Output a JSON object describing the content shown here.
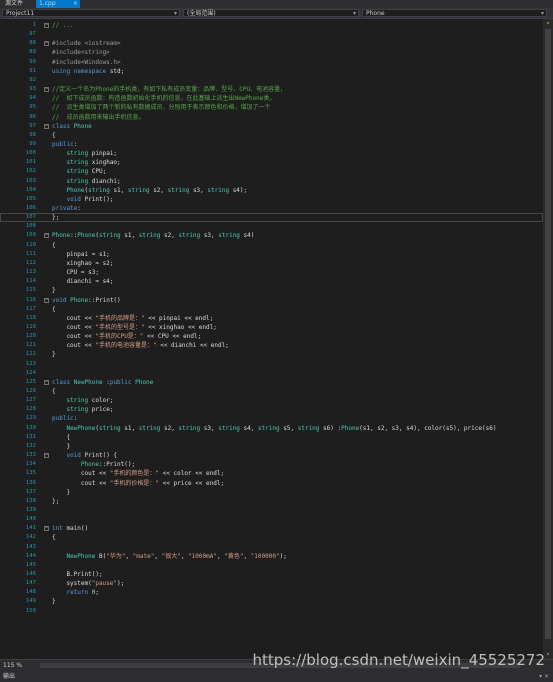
{
  "tabs": {
    "source": "源文件",
    "file": "1.cpp",
    "close": "×"
  },
  "nav": {
    "project": "Project11",
    "scope": "(全局范围)",
    "member": "Phone",
    "chev": "▾"
  },
  "lines": [
    {
      "n": "1",
      "t": "// ..."
    },
    {
      "n": "87",
      "t": ""
    },
    {
      "n": "88",
      "t": "#include <iostream>"
    },
    {
      "n": "89",
      "t": "#include<string>"
    },
    {
      "n": "90",
      "t": "#include<Windows.h>"
    },
    {
      "n": "91",
      "t": "using namespace std;"
    },
    {
      "n": "92",
      "t": ""
    },
    {
      "n": "93",
      "t": "//定义一个名为Phone的手机类，有如下私有成员变量：品牌、型号、CPU、电池容量，"
    },
    {
      "n": "94",
      "t": "//  如下成员函数：构造函数初始化手机的信息，在此基础上派生出NewPhone类，"
    },
    {
      "n": "95",
      "t": "//  派生类增加了两个新的私有数据成员，分别用于表示颜色和价格，增加了一个"
    },
    {
      "n": "96",
      "t": "//  成员函数用来输出手机信息。"
    },
    {
      "n": "97",
      "t": "class Phone"
    },
    {
      "n": "98",
      "t": "{"
    },
    {
      "n": "99",
      "t": "public:"
    },
    {
      "n": "100",
      "t": "    string pinpai;"
    },
    {
      "n": "101",
      "t": "    string xinghao;"
    },
    {
      "n": "102",
      "t": "    string CPU;"
    },
    {
      "n": "103",
      "t": "    string dianchi;"
    },
    {
      "n": "104",
      "t": "    Phone(string s1, string s2, string s3, string s4);"
    },
    {
      "n": "105",
      "t": "    void Print();"
    },
    {
      "n": "106",
      "t": "private:"
    },
    {
      "n": "107",
      "t": "};"
    },
    {
      "n": "108",
      "t": ""
    },
    {
      "n": "109",
      "t": "Phone::Phone(string s1, string s2, string s3, string s4)"
    },
    {
      "n": "110",
      "t": "{"
    },
    {
      "n": "111",
      "t": "    pinpai = s1;"
    },
    {
      "n": "112",
      "t": "    xinghao = s2;"
    },
    {
      "n": "113",
      "t": "    CPU = s3;"
    },
    {
      "n": "114",
      "t": "    dianchi = s4;"
    },
    {
      "n": "115",
      "t": "}"
    },
    {
      "n": "116",
      "t": "void Phone::Print()"
    },
    {
      "n": "117",
      "t": "{"
    },
    {
      "n": "118",
      "t": "    cout << \"手机的品牌是：\" << pinpai << endl;"
    },
    {
      "n": "119",
      "t": "    cout << \"手机的型号是：\" << xinghao << endl;"
    },
    {
      "n": "120",
      "t": "    cout << \"手机的CPU是：\" << CPU << endl;"
    },
    {
      "n": "121",
      "t": "    cout << \"手机的电池容量是：\" << dianchi << endl;"
    },
    {
      "n": "122",
      "t": "}"
    },
    {
      "n": "123",
      "t": ""
    },
    {
      "n": "124",
      "t": ""
    },
    {
      "n": "125",
      "t": "class NewPhone :public Phone"
    },
    {
      "n": "126",
      "t": "{"
    },
    {
      "n": "127",
      "t": "    string color;"
    },
    {
      "n": "128",
      "t": "    string price;"
    },
    {
      "n": "129",
      "t": "public:"
    },
    {
      "n": "130",
      "t": "    NewPhone(string s1, string s2, string s3, string s4, string s5, string s6) :Phone(s1, s2, s3, s4), color(s5), price(s6)"
    },
    {
      "n": "131",
      "t": "    {"
    },
    {
      "n": "132",
      "t": "    }"
    },
    {
      "n": "133",
      "t": "    void Print() {"
    },
    {
      "n": "134",
      "t": "        Phone::Print();"
    },
    {
      "n": "135",
      "t": "        cout << \"手机的颜色是：\" << color << endl;"
    },
    {
      "n": "136",
      "t": "        cout << \"手机的价格是：\" << price << endl;"
    },
    {
      "n": "137",
      "t": "    }"
    },
    {
      "n": "138",
      "t": "};"
    },
    {
      "n": "139",
      "t": ""
    },
    {
      "n": "140",
      "t": ""
    },
    {
      "n": "141",
      "t": "int main()"
    },
    {
      "n": "142",
      "t": "{"
    },
    {
      "n": "143",
      "t": ""
    },
    {
      "n": "144",
      "t": "    NewPhone B(\"华为\", \"mate\", \"很大\", \"1000mA\", \"黄色\", \"100000\");"
    },
    {
      "n": "145",
      "t": ""
    },
    {
      "n": "146",
      "t": "    B.Print();"
    },
    {
      "n": "147",
      "t": "    system(\"pause\");"
    },
    {
      "n": "148",
      "t": "    return 0;"
    },
    {
      "n": "149",
      "t": "}"
    },
    {
      "n": "150",
      "t": ""
    }
  ],
  "status": {
    "zoom": "115 %",
    "watermark": "https://blog.csdn.net/weixin_45525272"
  },
  "output": {
    "label": "输出",
    "controls": "▾ ✕"
  },
  "colors": {
    "keyword": "#569cd6",
    "string": "#d69d85",
    "comment": "#57a64a",
    "type": "#4ec9b0",
    "line_number": "#2b91af"
  }
}
